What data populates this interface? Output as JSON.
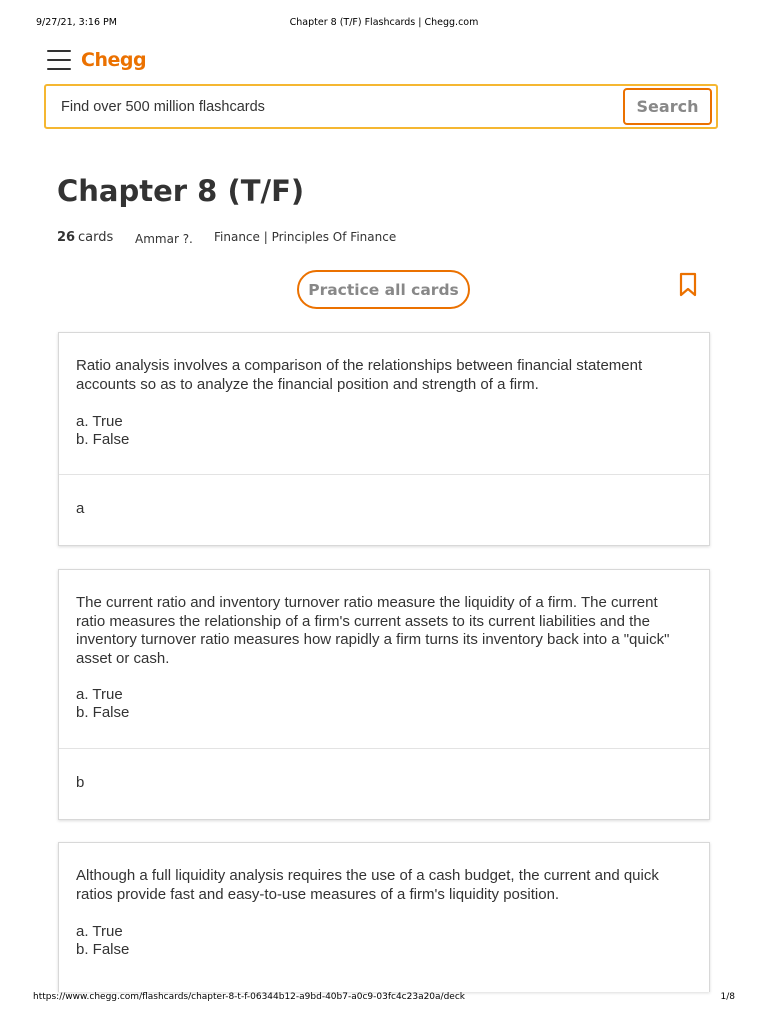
{
  "print_header": {
    "datetime": "9/27/21, 3:16 PM",
    "document_title": "Chapter 8 (T/F) Flashcards | Chegg.com"
  },
  "topbar": {
    "menu_icon": "hamburger-menu-icon",
    "logo_text": "Chegg"
  },
  "search": {
    "placeholder": "Find over 500 million flashcards",
    "value": "",
    "button_label": "Search"
  },
  "deck": {
    "title": "Chapter 8 (T/F)",
    "card_count": "26",
    "card_count_label": "cards",
    "author": "Ammar ?.",
    "subject": "Finance | Principles Of Finance",
    "practice_button_label": "Practice all cards",
    "bookmark_icon": "bookmark-icon"
  },
  "cards": [
    {
      "question": "Ratio analysis involves a comparison of the relationships between financial statement accounts so as to analyze the financial position and strength of a firm.",
      "option_a": "a. True",
      "option_b": "b. False",
      "answer": "a"
    },
    {
      "question": "The current ratio and inventory turnover ratio measure the liquidity of a firm.  The current ratio measures the relationship of a firm's current assets to its current liabilities and the inventory turnover ratio measures how rapidly a firm turns its inventory back into a \"quick\" asset or cash.",
      "option_a": "a. True",
      "option_b": "b. False",
      "answer": "b"
    },
    {
      "question": "Although a full liquidity analysis requires the use of a cash budget, the current and quick ratios provide fast and easy-to-use measures of a firm's liquidity position.",
      "option_a": "a. True",
      "option_b": "b. False"
    }
  ],
  "print_footer": {
    "url": "https://www.chegg.com/flashcards/chapter-8-t-f-06344b12-a9bd-40b7-a0c9-03fc4c23a20a/deck",
    "page": "1/8"
  },
  "colors": {
    "brand_orange": "#eb7100",
    "search_border": "#f5b731",
    "text": "#333333"
  }
}
